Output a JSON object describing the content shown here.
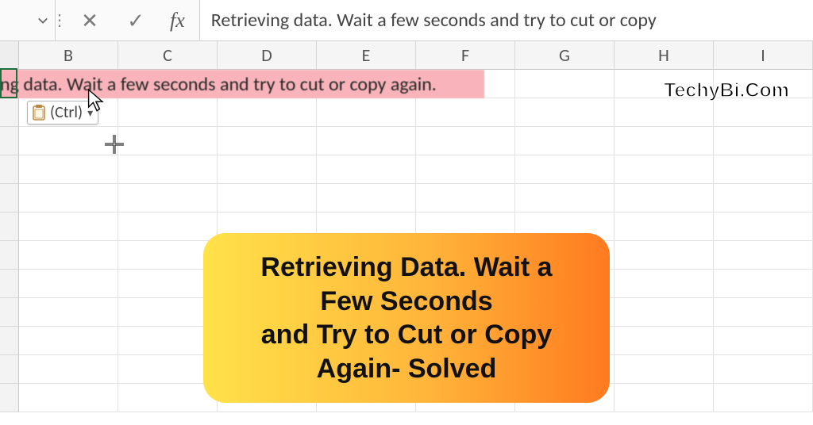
{
  "formula_bar": {
    "cancel_glyph": "✕",
    "accept_glyph": "✓",
    "fx_label": "fx",
    "value": "Retrieving data. Wait a few seconds and try to cut or copy"
  },
  "columns": [
    "B",
    "C",
    "D",
    "E",
    "F",
    "G",
    "H",
    "I"
  ],
  "cell_text": "ng data. Wait a few seconds and try to cut or copy again.",
  "paste_tag": {
    "label": "(Ctrl)",
    "chevron": "▾"
  },
  "watermark": "TechyBi.Com",
  "banner_line1": "Retrieving Data. Wait a Few Seconds",
  "banner_line2": "and Try to Cut or Copy Again- Solved",
  "colors": {
    "highlight": "#f8b4ba",
    "banner_start": "#ffe24a",
    "banner_end": "#ff7a1f",
    "active_border": "#1a6f3c"
  }
}
